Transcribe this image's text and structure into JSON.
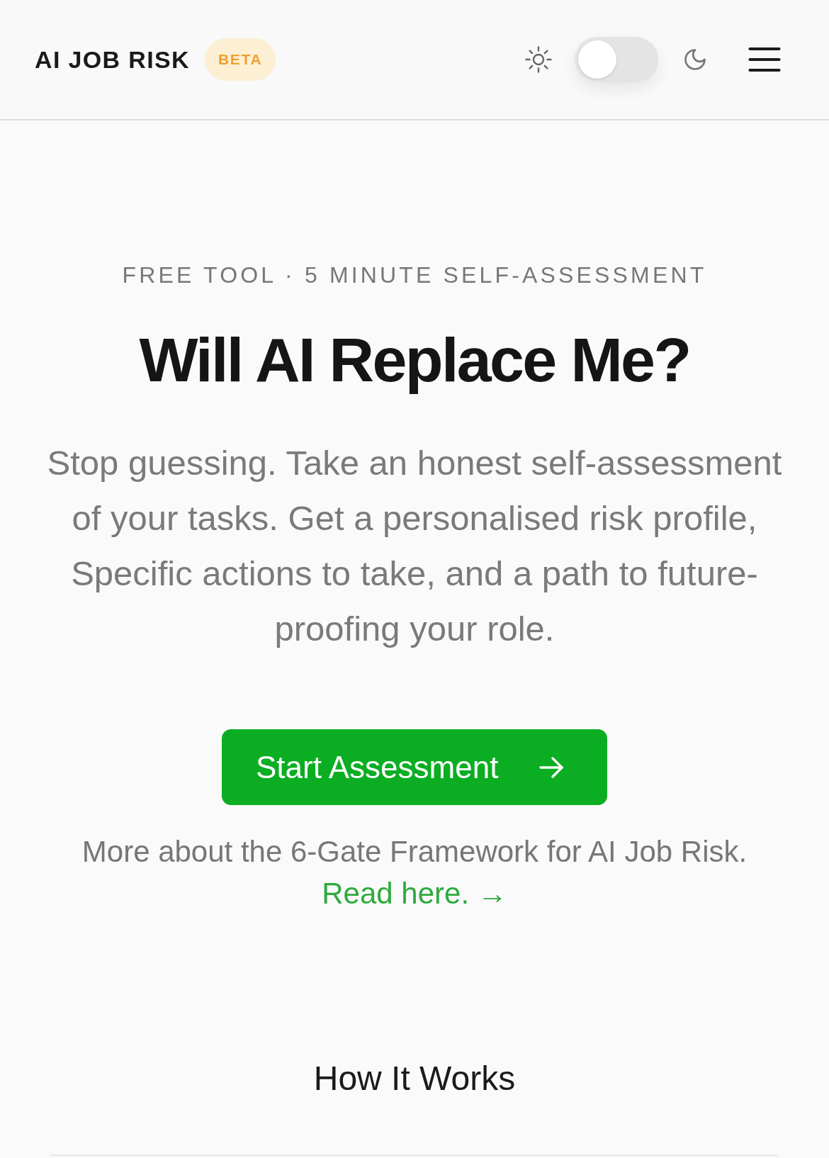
{
  "header": {
    "logo": "AI JOB RISK",
    "badge": "BETA",
    "theme_toggle": {
      "on": false
    }
  },
  "hero": {
    "eyebrow": "FREE TOOL · 5 MINUTE SELF-ASSESSMENT",
    "title": "Will AI Replace Me?",
    "description": "Stop guessing. Take an honest self-assessment of your tasks. Get a personalised risk profile, Specific actions to take, and a path to future-proofing your role.",
    "cta": {
      "label": "Start Assessment"
    },
    "note": "More about the 6-Gate Framework for AI Job Risk.",
    "link": "Read here. →"
  },
  "how_it_works": {
    "title": "How It Works"
  }
}
